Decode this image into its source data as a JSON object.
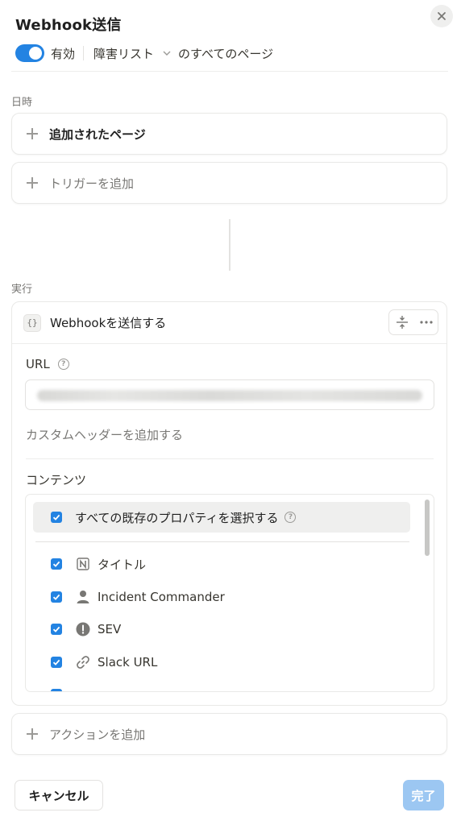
{
  "header": {
    "title": "Webhook送信",
    "close_icon": "close-icon"
  },
  "status": {
    "enabled": true,
    "enabled_label": "有効",
    "database_name": "障害リスト",
    "scope_suffix": "のすべてのページ"
  },
  "trigger_section": {
    "label": "日時",
    "trigger": "追加されたページ",
    "add_trigger": "トリガーを追加"
  },
  "action_section": {
    "label": "実行",
    "action_title": "Webhookを送信する",
    "url_label": "URL",
    "url_value": "",
    "add_custom_header": "カスタムヘッダーを追加する",
    "content_label": "コンテンツ",
    "select_all": "すべての既存のプロパティを選択する",
    "properties": [
      {
        "label": "タイトル",
        "icon": "notion-icon",
        "checked": true
      },
      {
        "label": "Incident Commander",
        "icon": "person-icon",
        "checked": true
      },
      {
        "label": "SEV",
        "icon": "exclamation-icon",
        "checked": true
      },
      {
        "label": "Slack URL",
        "icon": "link-icon",
        "checked": true
      }
    ],
    "add_action": "アクションを追加"
  },
  "footer": {
    "cancel": "キャンセル",
    "done": "完了"
  },
  "colors": {
    "accent": "#2383e2",
    "done_disabled": "#9cc7f2"
  }
}
